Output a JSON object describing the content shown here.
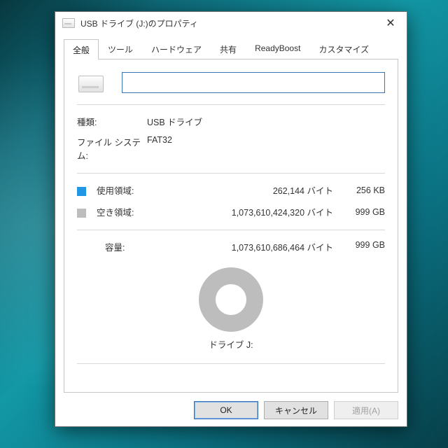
{
  "titlebar": {
    "title": "USB ドライブ (J:)のプロパティ"
  },
  "tabs": {
    "general": "全般",
    "tools": "ツール",
    "hardware": "ハードウェア",
    "sharing": "共有",
    "readyboost": "ReadyBoost",
    "customize": "カスタマイズ"
  },
  "fields": {
    "name_value": "",
    "type_label": "種類:",
    "type_value": "USB ドライブ",
    "fs_label": "ファイル システム:",
    "fs_value": "FAT32",
    "used_label": "使用領域:",
    "used_bytes": "262,144 バイト",
    "used_size": "256 KB",
    "free_label": "空き領域:",
    "free_bytes": "1,073,610,424,320 バイト",
    "free_size": "999 GB",
    "capacity_label": "容量:",
    "capacity_bytes": "1,073,610,686,464 バイト",
    "capacity_size": "999 GB",
    "drive_label": "ドライブ J:"
  },
  "buttons": {
    "ok": "OK",
    "cancel": "キャンセル",
    "apply": "適用(A)"
  },
  "colors": {
    "used": "#2196e3",
    "free": "#bdbdbd"
  }
}
